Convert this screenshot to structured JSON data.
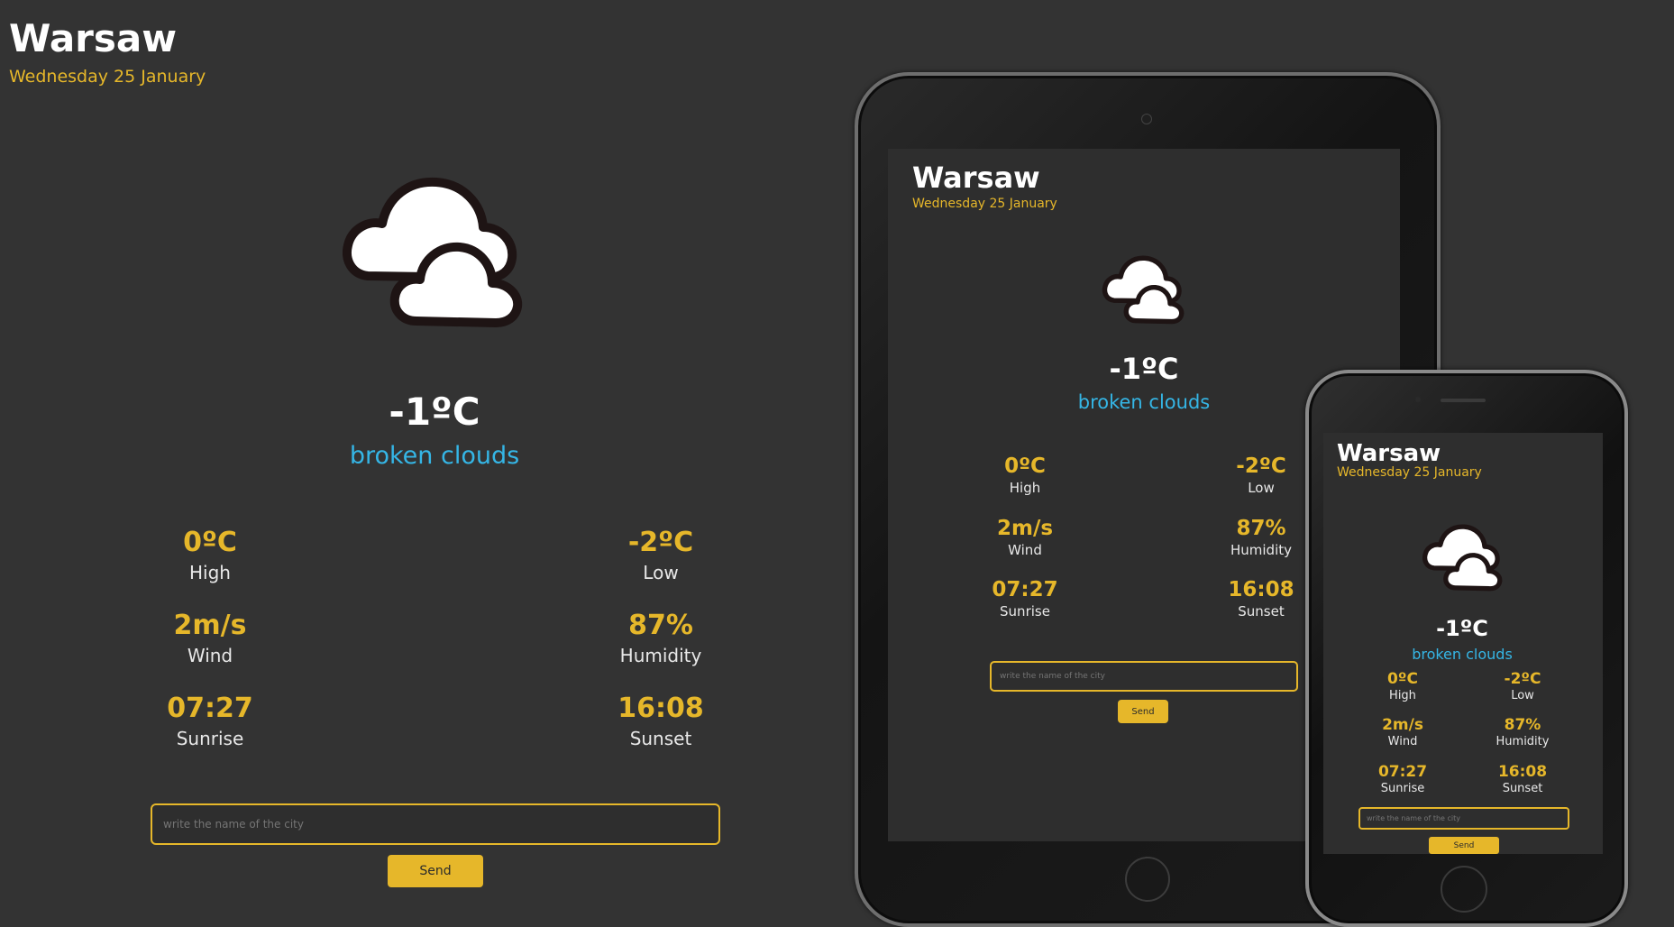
{
  "city": "Warsaw",
  "date": "Wednesday 25 January",
  "weather": {
    "temp": "-1ºC",
    "description": "broken clouds",
    "icon": "broken-clouds-icon"
  },
  "stats": {
    "high": {
      "value": "0ºC",
      "label": "High"
    },
    "low": {
      "value": "-2ºC",
      "label": "Low"
    },
    "wind": {
      "value": "2m/s",
      "label": "Wind"
    },
    "humidity": {
      "value": "87%",
      "label": "Humidity"
    },
    "sunrise": {
      "value": "07:27",
      "label": "Sunrise"
    },
    "sunset": {
      "value": "16:08",
      "label": "Sunset"
    }
  },
  "search": {
    "placeholder": "write the name of the city",
    "button_label": "Send"
  },
  "colors": {
    "background": "#333333",
    "accent": "#e6b72a",
    "description": "#35b6e6",
    "text": "#ffffff"
  }
}
